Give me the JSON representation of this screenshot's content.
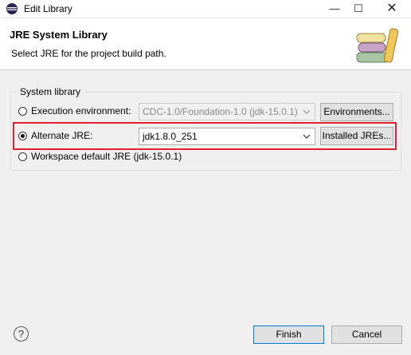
{
  "window": {
    "title": "Edit Library"
  },
  "header": {
    "title": "JRE System Library",
    "description": "Select JRE for the project build path."
  },
  "group": {
    "label": "System library"
  },
  "options": {
    "execution_env": {
      "label": "Execution environment:",
      "selected": false,
      "value": "CDC-1.0/Foundation-1.0 (jdk-15.0.1)",
      "button": "Environments..."
    },
    "alternate_jre": {
      "label": "Alternate JRE:",
      "selected": true,
      "value": "jdk1.8.0_251",
      "button": "Installed JREs..."
    },
    "workspace_default": {
      "label": "Workspace default JRE (jdk-15.0.1)",
      "selected": false
    }
  },
  "footer": {
    "help": "?",
    "finish": "Finish",
    "cancel": "Cancel"
  },
  "colors": {
    "highlight": "#e0202e",
    "default_button_border": "#0078d7"
  }
}
